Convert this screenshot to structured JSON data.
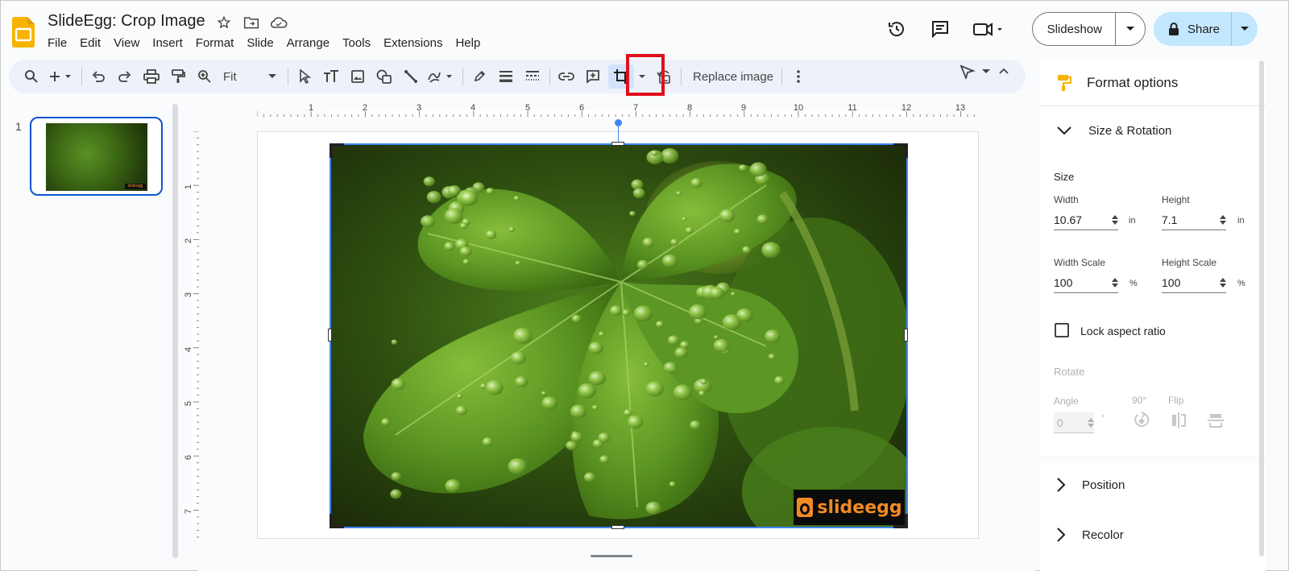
{
  "document": {
    "title": "SlideEgg: Crop Image"
  },
  "menu": [
    "File",
    "Edit",
    "View",
    "Insert",
    "Format",
    "Slide",
    "Arrange",
    "Tools",
    "Extensions",
    "Help"
  ],
  "header": {
    "slideshow_label": "Slideshow",
    "share_label": "Share"
  },
  "toolbar": {
    "zoom_value": "Fit",
    "replace_image_label": "Replace image"
  },
  "filmstrip": {
    "slide_number": "1"
  },
  "rulers": {
    "horizontal": [
      "1",
      "2",
      "3",
      "4",
      "5",
      "6",
      "7",
      "8",
      "9",
      "10",
      "11",
      "12",
      "13"
    ],
    "vertical": [
      "1",
      "2",
      "3",
      "4",
      "5",
      "6",
      "7"
    ]
  },
  "watermark": {
    "text": "slideegg"
  },
  "format_panel": {
    "title": "Format options",
    "size_rotation": {
      "title": "Size & Rotation",
      "size_label": "Size",
      "width_label": "Width",
      "width_value": "10.67",
      "width_unit": "in",
      "height_label": "Height",
      "height_value": "7.1",
      "height_unit": "in",
      "width_scale_label": "Width Scale",
      "width_scale_value": "100",
      "width_scale_unit": "%",
      "height_scale_label": "Height Scale",
      "height_scale_value": "100",
      "height_scale_unit": "%",
      "lock_aspect_label": "Lock aspect ratio",
      "rotate_label": "Rotate",
      "angle_label": "Angle",
      "angle_value": "0",
      "angle_unit": "°",
      "rotate90_label": "90°",
      "flip_label": "Flip"
    },
    "position_title": "Position",
    "recolor_title": "Recolor"
  },
  "colors": {
    "accent_blue": "#0b57d0",
    "share_bg": "#c2e7ff",
    "highlight_red": "#e0101c",
    "logo_yellow": "#f6b400"
  }
}
